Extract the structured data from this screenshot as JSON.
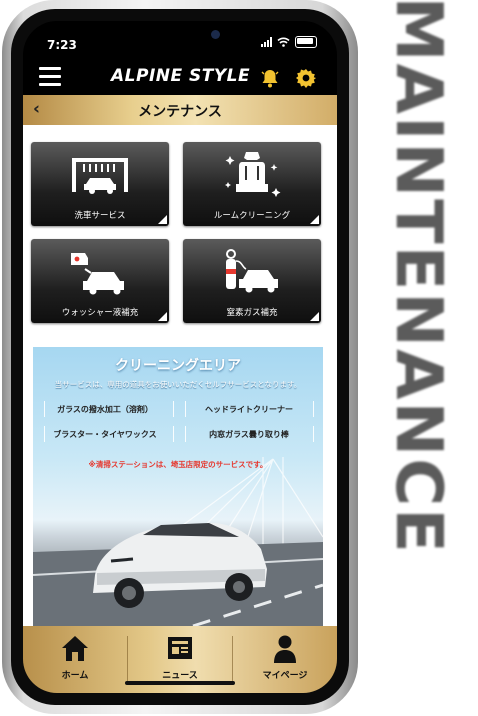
{
  "side_wordmark": "MAINTENANCE",
  "status_bar": {
    "time": "7:23"
  },
  "app_bar": {
    "brand": "ALPINE STYLE"
  },
  "page": {
    "title": "メンテナンス"
  },
  "services": [
    {
      "label": "洗車サービス",
      "icon": "car-wash-icon"
    },
    {
      "label": "ルームクリーニング",
      "icon": "car-seat-cleaning-icon"
    },
    {
      "label": "ウォッシャー液補充",
      "icon": "washer-fluid-icon"
    },
    {
      "label": "窒素ガス補充",
      "icon": "nitrogen-gas-icon"
    }
  ],
  "cleaning_area": {
    "title": "クリーニングエリア",
    "subtitle": "当サービスは、専用の道具をお使いいただくセルフサービスとなります。",
    "items": [
      "ガラスの撥水加工（溶剤）",
      "ヘッドライトクリーナー",
      "ブラスター・タイヤワックス",
      "内窓ガラス曇り取り棒"
    ],
    "notice": "※清掃ステーションは、埼玉店限定のサービスです。"
  },
  "tabs": [
    {
      "label": "ホーム",
      "icon": "home-icon"
    },
    {
      "label": "ニュース",
      "icon": "news-icon"
    },
    {
      "label": "マイページ",
      "icon": "person-icon"
    }
  ],
  "colors": {
    "gold_light": "#f0ddae",
    "gold_dark": "#b8904b",
    "notice_red": "#e6372e",
    "accent_blue": "#a6d7f1"
  }
}
